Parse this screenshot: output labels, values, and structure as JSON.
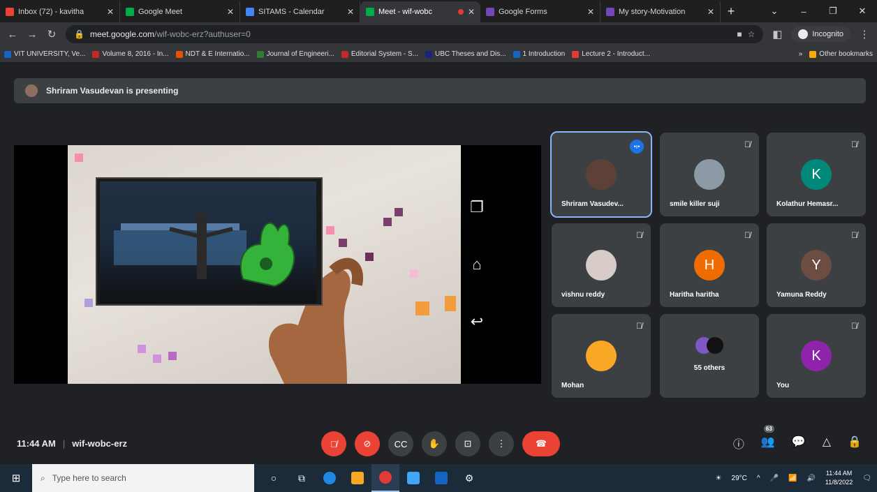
{
  "tabs": [
    {
      "title": "Inbox (72) - kavitha",
      "favicon_color": "#ea4335",
      "active": false
    },
    {
      "title": "Google Meet",
      "favicon_color": "#00ac47",
      "active": false
    },
    {
      "title": "SITAMS - Calendar",
      "favicon_color": "#4285f4",
      "active": false
    },
    {
      "title": "Meet - wif-wobc",
      "favicon_color": "#00ac47",
      "active": true
    },
    {
      "title": "Google Forms",
      "favicon_color": "#7248b9",
      "active": false
    },
    {
      "title": "My story-Motivation",
      "favicon_color": "#7248b9",
      "active": false
    }
  ],
  "address": {
    "host": "meet.google.com",
    "path": "/wif-wobc-erz?authuser=0",
    "incognito_label": "Incognito"
  },
  "bookmarks": [
    {
      "label": "VIT UNIVERSITY, Ve...",
      "color": "#1565c0"
    },
    {
      "label": "Volume 8, 2016 - In...",
      "color": "#c62828"
    },
    {
      "label": "NDT & E Internatio...",
      "color": "#e65100"
    },
    {
      "label": "Journal of Engineeri...",
      "color": "#2e7d32"
    },
    {
      "label": "Editorial System - S...",
      "color": "#c62828"
    },
    {
      "label": "UBC Theses and Dis...",
      "color": "#1a237e"
    },
    {
      "label": "1 Introduction",
      "color": "#1565c0"
    },
    {
      "label": "Lecture 2 - Introduct...",
      "color": "#e53935"
    }
  ],
  "bookmarks_more": "»",
  "other_bookmarks": "Other bookmarks",
  "banner": {
    "text": "Shriram Vasudevan is presenting"
  },
  "participants": [
    {
      "name": "Shriram Vasudev...",
      "speaking": true,
      "avatar_type": "photo",
      "avatar_color": "#5d4037"
    },
    {
      "name": "smile killer suji",
      "speaking": false,
      "avatar_type": "photo",
      "avatar_color": "#8d9aa5"
    },
    {
      "name": "Kolathur Hemasr...",
      "speaking": false,
      "avatar_type": "letter",
      "letter": "K",
      "avatar_color": "#00897b"
    },
    {
      "name": "vishnu reddy",
      "speaking": false,
      "avatar_type": "photo",
      "avatar_color": "#d7ccc8"
    },
    {
      "name": "Haritha haritha",
      "speaking": false,
      "avatar_type": "letter",
      "letter": "H",
      "avatar_color": "#ef6c00"
    },
    {
      "name": "Yamuna Reddy",
      "speaking": false,
      "avatar_type": "letter",
      "letter": "Y",
      "avatar_color": "#6d4c41"
    },
    {
      "name": "Mohan",
      "speaking": false,
      "avatar_type": "photo",
      "avatar_color": "#f9a825"
    },
    {
      "name": "55 others",
      "speaking": false,
      "avatar_type": "group"
    },
    {
      "name": "You",
      "speaking": false,
      "avatar_type": "letter",
      "letter": "K",
      "avatar_color": "#8e24aa"
    }
  ],
  "meeting": {
    "time": "11:44 AM",
    "code": "wif-wobc-erz",
    "people_count": "63"
  },
  "taskbar": {
    "search_placeholder": "Type here to search",
    "weather": "29°C",
    "clock_time": "11:44 AM",
    "clock_date": "11/8/2022"
  }
}
